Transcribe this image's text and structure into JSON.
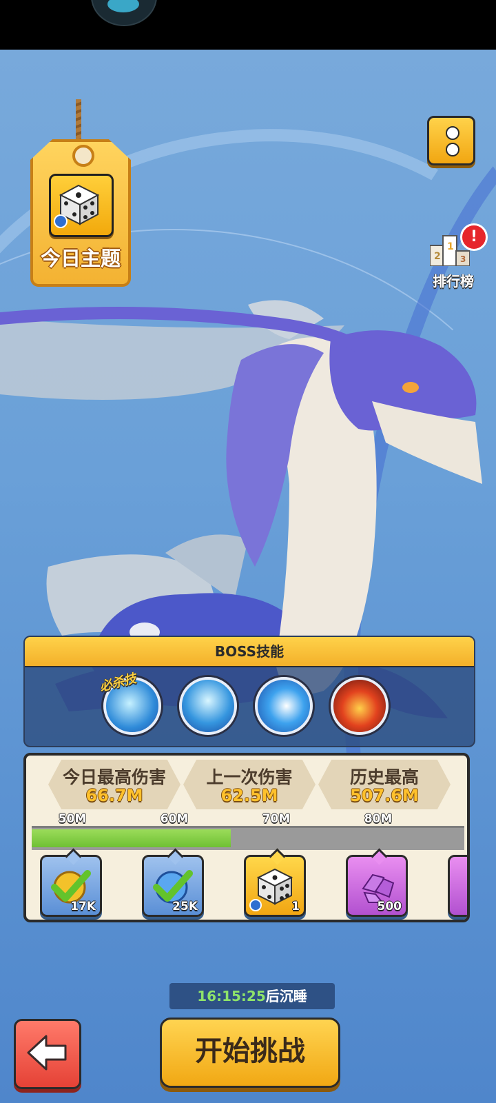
{
  "theme_tag": {
    "label": "今日主题",
    "icon": "dice-icon"
  },
  "top_right": {
    "menu_icon": "more-icon",
    "ranking_label": "排行榜",
    "ranking_alert": "!"
  },
  "boss_skills": {
    "header": "BOSS技能",
    "ultimate_tag": "必杀技",
    "skills": [
      {
        "icon": "water-blast-icon"
      },
      {
        "icon": "tidal-wave-icon"
      },
      {
        "icon": "water-orb-icon"
      },
      {
        "icon": "fire-beast-icon"
      }
    ]
  },
  "damage": {
    "stats": [
      {
        "title": "今日最高伤害",
        "value": "66.7M"
      },
      {
        "title": "上一次伤害",
        "value": "62.5M"
      },
      {
        "title": "历史最高",
        "value": "507.6M"
      }
    ],
    "thresholds": [
      "50M",
      "60M",
      "70M",
      "80M"
    ],
    "progress_fraction": 0.46,
    "rewards": [
      {
        "icon": "gold-check-icon",
        "count": "17K"
      },
      {
        "icon": "blue-check-icon",
        "count": "25K"
      },
      {
        "icon": "dice-icon",
        "count": "1"
      },
      {
        "icon": "purple-gem-icon",
        "count": "500"
      }
    ]
  },
  "timer": {
    "time": "16:15:25",
    "suffix": "后沉睡"
  },
  "buttons": {
    "back_icon": "arrow-left-icon",
    "start": "开始挑战"
  },
  "colors": {
    "accent_yellow": "#f6b52c",
    "progress_green": "#7fcd3f",
    "back_red": "#e8473b"
  }
}
